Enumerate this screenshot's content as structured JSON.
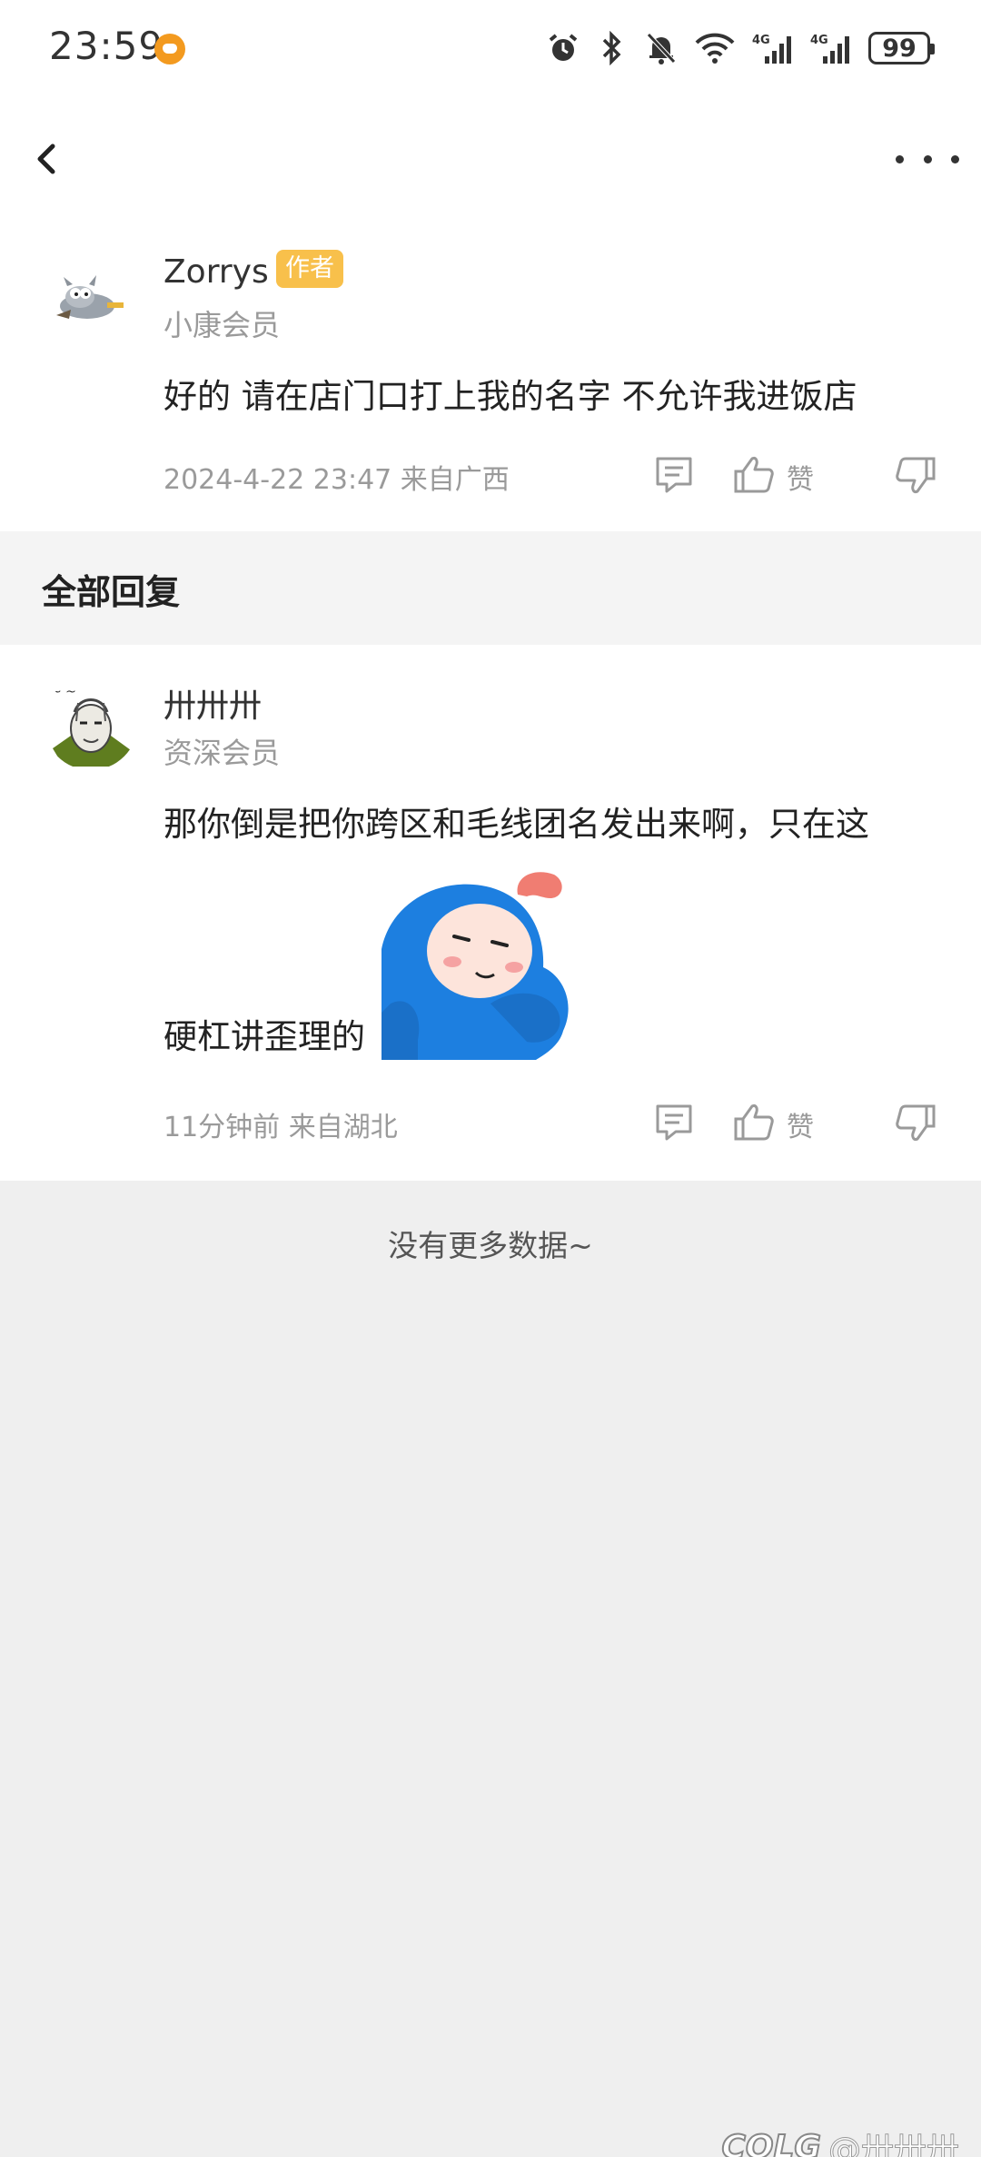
{
  "status_bar": {
    "time": "23:59",
    "battery": "99"
  },
  "main_comment": {
    "username": "Zorrys",
    "badge": "作者",
    "member_level": "小康会员",
    "content": "好的  请在店门口打上我的名字  不允许我进饭店",
    "meta": "2024-4-22 23:47  来自广西",
    "like_label": "赞"
  },
  "section": {
    "title": "全部回复"
  },
  "reply": {
    "username": "卅卅卅",
    "member_level": "资深会员",
    "content_line1": "那你倒是把你跨区和毛线团名发出来啊，只在这",
    "content_line2": "硬杠讲歪理的",
    "meta": "11分钟前 来自湖北",
    "like_label": "赞"
  },
  "footer": {
    "no_more": "没有更多数据~"
  },
  "watermark": {
    "logo": "COLG",
    "user": "@卅卅卅"
  },
  "colors": {
    "badge": "#f8c04b",
    "app_icon": "#f39a1f",
    "sticker_blue": "#1d7fe0"
  },
  "icons": [
    "app-notification-icon",
    "alarm-icon",
    "bluetooth-icon",
    "mute-bell-icon",
    "wifi-icon",
    "signal-4g-icon",
    "back-chevron-icon",
    "more-dots-icon",
    "comment-icon",
    "thumbs-up-icon",
    "thumbs-down-icon"
  ]
}
